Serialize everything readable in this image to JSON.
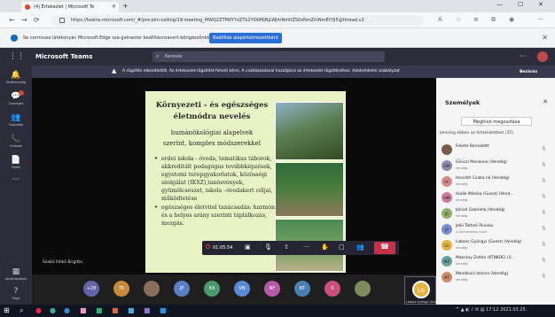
{
  "browser": {
    "tab_title": "(4) Értekezlet | Microsoft Te",
    "new_tab": "+",
    "url": "https://teams.microsoft.com/_#/pre-join-calling/19:meeting_MWQ2ZTM0YYzZTk2Yi00MjNjLWJmNmItZS0zNmZmNmEtYjI5@thread.v2",
    "nav": {
      "back": "←",
      "forward": "→",
      "reload": "⟳"
    },
    "window_controls": {
      "min": "—",
      "max": "☐",
      "close": "✕"
    }
  },
  "infobar": {
    "text": "Se corrrouse látékonyác Microsoft Edge sza-galnaster beállításnsavert-böngészőnkk?",
    "button": "Beállítás alapértelmezettként",
    "close": "✕"
  },
  "teams": {
    "app_name": "Microsoft Teams",
    "search_placeholder": "Keresés",
    "more": "···"
  },
  "rail": [
    {
      "icon": "🔔",
      "label": "Tevékenység"
    },
    {
      "icon": "💬",
      "label": "Csevegés"
    },
    {
      "icon": "👥",
      "label": "Csapatok"
    },
    {
      "icon": "📞",
      "label": "Hívások"
    },
    {
      "icon": "📄",
      "label": "Fájlok"
    },
    {
      "icon": "···",
      "label": ""
    },
    {
      "icon": "▦",
      "label": "Alkalmazások"
    },
    {
      "icon": "?",
      "label": "Súgó"
    }
  ],
  "warning": {
    "icon": "▲",
    "text": "A rögzítés elkezdődött. Az értekezlet-rögzítést felveti kérni. A csatlakozással hozzájárul az értekezlet rögzítéséhez. Adatvédelmi szabályzat",
    "button": "Bezárás"
  },
  "slide": {
    "title_line1": "Környezeti - és egészséges",
    "title_line2": "életmódra nevelés",
    "subtitle_line1": "humánökológiai alapelvek",
    "subtitle_line2": "szerint, komplex módszerekkel",
    "bullets": [
      "erdei iskola - óvoda, tematikus táborok, akkreditált pedagógus továbbképzések, egyetemi terepgyakorlatok, közösségi szolgálat (IKSZ),tanösvények, gyümölcsészet, iskola –óvodakert céljai, működtetése",
      "egészséges életvitel tanácsadás: harmónia és a helyes arány szerinti táplálkozás, mozgás."
    ]
  },
  "call": {
    "timer": "01:05:54",
    "presenter": "Szabó Ildikó Brigitta"
  },
  "participants_strip": [
    {
      "label": "+28",
      "color": "#6264a7"
    },
    {
      "label": "TK",
      "color": "#c58a3a"
    },
    {
      "label": "",
      "color": "#8a6d5a"
    },
    {
      "label": "JP",
      "color": "#5b7fc4"
    },
    {
      "label": "EA",
      "color": "#4a9a6d"
    },
    {
      "label": "VN",
      "color": "#5a8bd6"
    },
    {
      "label": "NF",
      "color": "#b75aa6"
    },
    {
      "label": "BT",
      "color": "#4a7fb5"
    },
    {
      "label": "S",
      "color": "#c94f7c"
    },
    {
      "label": "",
      "color": "#7d8a5a"
    }
  ],
  "self_tile": {
    "initials": "LG",
    "name": "Labanc Gyöngyi (Guest) (V"
  },
  "panel": {
    "title": "Személyek",
    "close": "✕",
    "share": "Meghívó megosztása",
    "group": "Jelenleg ebben az értekezletben (35)",
    "people": [
      {
        "initials": "",
        "name": "Fekete Bernadett",
        "role": "",
        "color": "#7a5a4a"
      },
      {
        "initials": "GM",
        "name": "Gönczi Marianna (Vendég)",
        "role": "Vendég",
        "color": "#8b8bb0"
      },
      {
        "initials": "HC",
        "name": "Horváth Csaba né (Vendég)",
        "role": "Vendég",
        "color": "#d98a8a"
      },
      {
        "initials": "HM",
        "name": "Hulák Mónika (Guest) (Vend...",
        "role": "Vendég",
        "color": "#c97a9a"
      },
      {
        "initials": "JG",
        "name": "Jálnok Gabriella (Vendég)",
        "role": "Vendég",
        "color": "#8fb06a"
      },
      {
        "initials": "JP",
        "name": "Jelki Tóthné Piroska",
        "role": "A szervezeten kívül",
        "color": "#7a8fd0"
      },
      {
        "initials": "LG",
        "name": "Labanc Gyöngyi (Guest) (Vendég)",
        "role": "Vendég",
        "color": "#e3b341"
      },
      {
        "initials": "MZ",
        "name": "Makrány Zoltán (KTNKOE) (V...",
        "role": "Vendég",
        "color": "#6aa0a0"
      },
      {
        "initials": "MT",
        "name": "Mandziuci Izmina (Vendég)",
        "role": "Vendég",
        "color": "#d08a6a"
      }
    ]
  },
  "tray": {
    "time": "17:12",
    "date": "2021.03.25."
  }
}
